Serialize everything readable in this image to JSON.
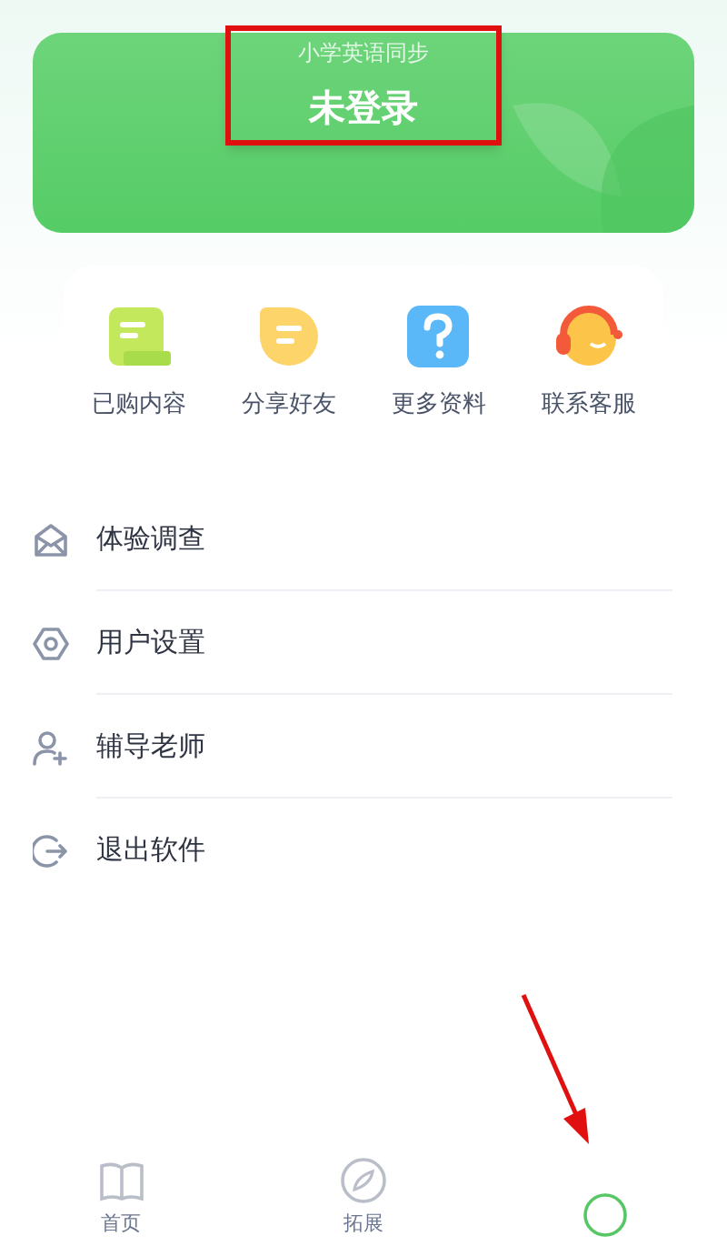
{
  "header": {
    "subtitle": "小学英语同步",
    "title": "未登录"
  },
  "annotations": {
    "highlight_box": true,
    "arrow": true
  },
  "shortcuts": [
    {
      "kind": "purchased",
      "label": "已购内容"
    },
    {
      "kind": "share",
      "label": "分享好友"
    },
    {
      "kind": "help",
      "label": "更多资料"
    },
    {
      "kind": "service",
      "label": "联系客服"
    }
  ],
  "menu": [
    {
      "kind": "mail",
      "label": "体验调查"
    },
    {
      "kind": "settings",
      "label": "用户设置"
    },
    {
      "kind": "add_user",
      "label": "辅导老师"
    },
    {
      "kind": "logout",
      "label": "退出软件"
    }
  ],
  "tab_bar": [
    {
      "kind": "book",
      "label": "首页",
      "selected": false
    },
    {
      "kind": "compass",
      "label": "拓展",
      "selected": false
    },
    {
      "kind": "circle",
      "selected": true
    }
  ]
}
